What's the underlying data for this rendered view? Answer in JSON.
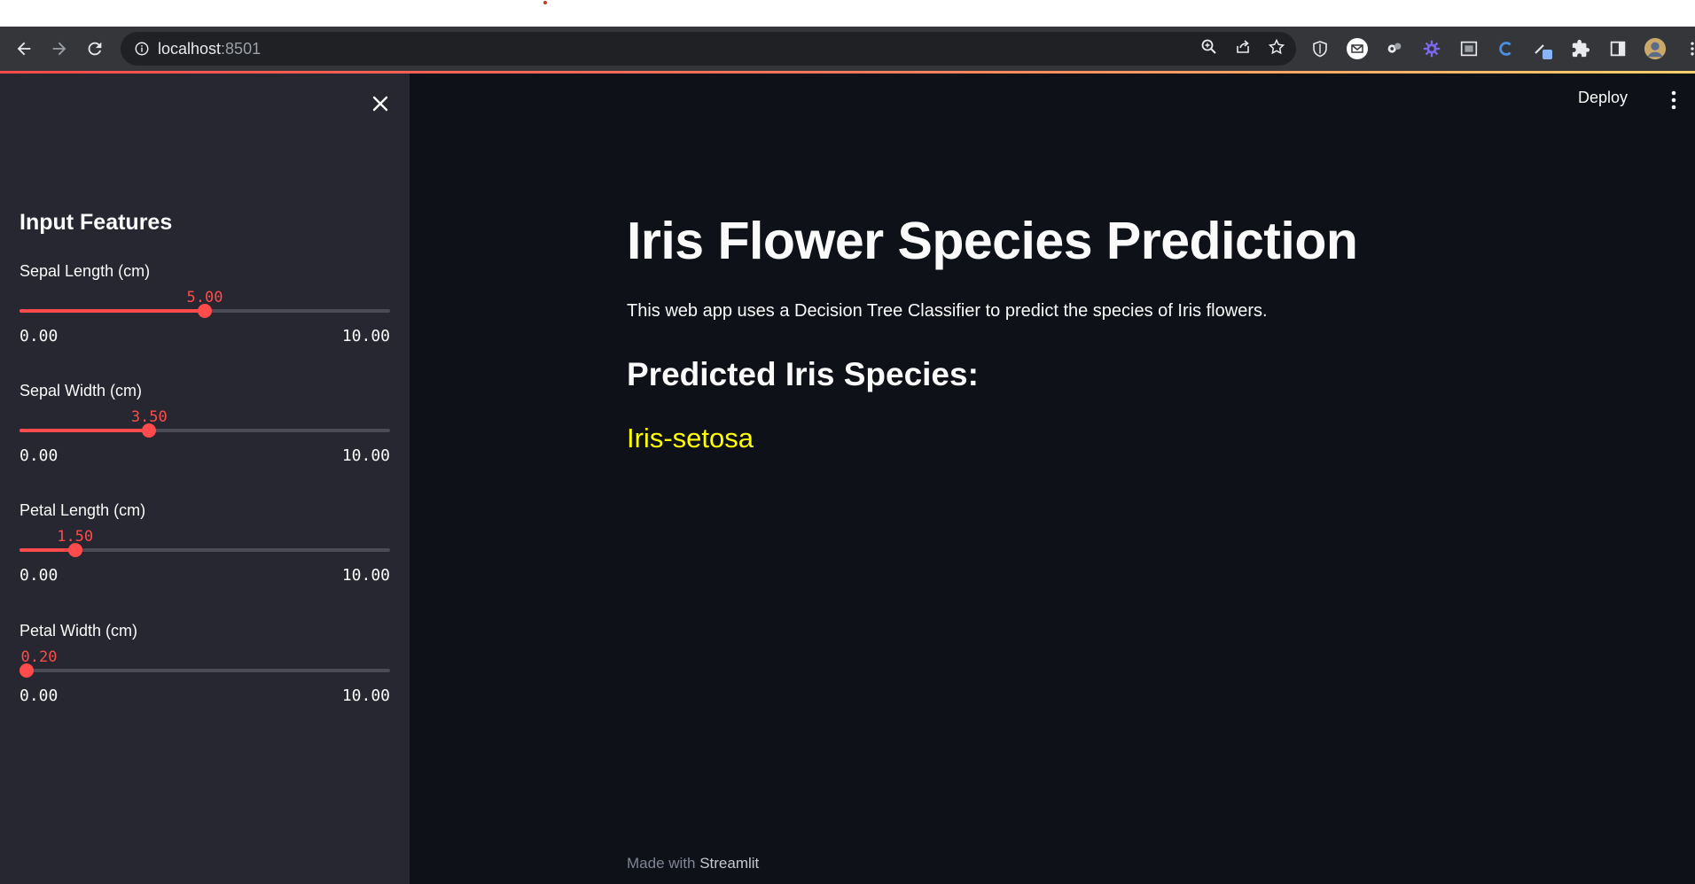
{
  "browser": {
    "url_host": "localhost",
    "url_port": ":8501"
  },
  "header": {
    "deploy_label": "Deploy"
  },
  "sidebar": {
    "title": "Input Features",
    "sliders": [
      {
        "label": "Sepal Length (cm)",
        "value": "5.00",
        "min": "0.00",
        "max": "10.00",
        "fraction": 0.5
      },
      {
        "label": "Sepal Width (cm)",
        "value": "3.50",
        "min": "0.00",
        "max": "10.00",
        "fraction": 0.35
      },
      {
        "label": "Petal Length (cm)",
        "value": "1.50",
        "min": "0.00",
        "max": "10.00",
        "fraction": 0.15
      },
      {
        "label": "Petal Width (cm)",
        "value": "0.20",
        "min": "0.00",
        "max": "10.00",
        "fraction": 0.02
      }
    ]
  },
  "main": {
    "title": "Iris Flower Species Prediction",
    "description": "This web app uses a Decision Tree Classifier to predict the species of Iris flowers.",
    "prediction_heading": "Predicted Iris Species:",
    "prediction_result": "Iris-setosa"
  },
  "footer": {
    "made_with": "Made with ",
    "brand": "Streamlit"
  },
  "colors": {
    "accent": "#ff4b4b",
    "result": "#ffff00",
    "background": "#0e1117",
    "sidebar": "#262730"
  }
}
